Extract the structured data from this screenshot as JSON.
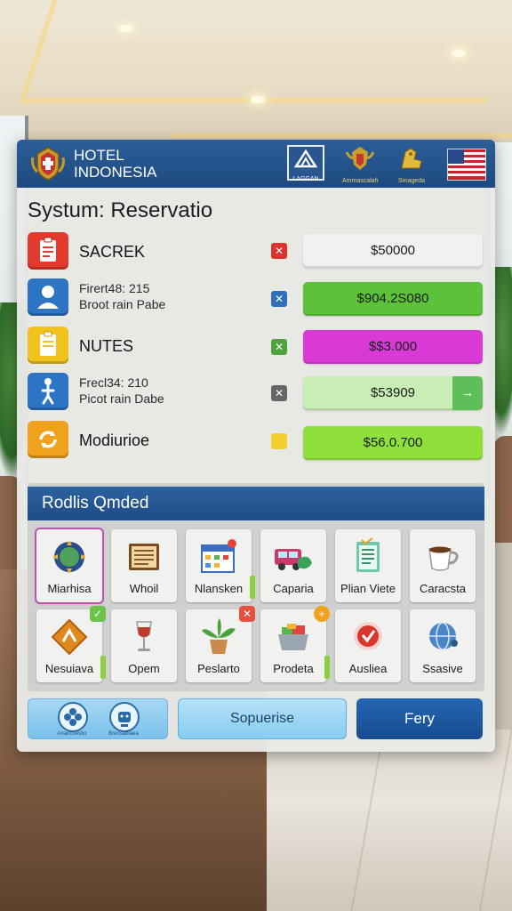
{
  "header": {
    "title_line1": "HOTEL",
    "title_line2": "INDONESIA",
    "badge1_label": "LAGGAN",
    "badge2_label": "Ammascalah",
    "badge3_label": "Smageda"
  },
  "page_title": "Systum: Reservatio",
  "rows": [
    {
      "label": "SACREK",
      "sub1": "",
      "sub2": "",
      "value": "$50000",
      "icon": "clipboard-icon",
      "mini_icon": "cross-mark-icon"
    },
    {
      "label": "",
      "sub1": "Firert48: 215",
      "sub2": "Broot rain Pabe",
      "value": "$904.2S080",
      "icon": "user-icon",
      "mini_icon": "tools-icon"
    },
    {
      "label": "NUTES",
      "sub1": "",
      "sub2": "",
      "value": "$$3.000",
      "icon": "notes-icon",
      "mini_icon": "check-grid-icon"
    },
    {
      "label": "",
      "sub1": "Frecl34: 210",
      "sub2": "Picot rain Dabe",
      "value": "$53909",
      "icon": "walking-person-icon",
      "mini_icon": "cross-tools-icon",
      "arrow": "→"
    },
    {
      "label": "Modiurioe",
      "sub1": "",
      "sub2": "",
      "value": "$56.0.700",
      "icon": "refresh-icon",
      "mini_icon": "yellow-square-icon"
    }
  ],
  "modules": {
    "title": "Rodlis Qmded",
    "tiles": [
      {
        "label": "Miarhisa",
        "icon": "emblem-icon"
      },
      {
        "label": "Whoil",
        "icon": "notebook-icon"
      },
      {
        "label": "Nlansken",
        "icon": "calendar-map-icon"
      },
      {
        "label": "Caparia",
        "icon": "truck-icon"
      },
      {
        "label": "Plian Viete",
        "icon": "checklist-icon"
      },
      {
        "label": "Caracsta",
        "icon": "coffee-cup-icon"
      },
      {
        "label": "Nesuiava",
        "icon": "diamond-sign-icon"
      },
      {
        "label": "Opem",
        "icon": "wine-glass-icon"
      },
      {
        "label": "Peslarto",
        "icon": "potted-plant-icon"
      },
      {
        "label": "Prodeta",
        "icon": "laundry-basket-icon"
      },
      {
        "label": "Ausliea",
        "icon": "heart-badge-icon"
      },
      {
        "label": "Ssasive",
        "icon": "globe-icon"
      }
    ]
  },
  "bottom": {
    "left_caption1": "Anancoestio",
    "left_caption2": "Brensadlaea",
    "middle_label": "Sopuerise",
    "right_label": "Fery"
  },
  "colors": {
    "header_blue": "#1d4a80",
    "pill_white": "#f1f1f1",
    "pill_green": "#5cc23a",
    "pill_magenta": "#d93ad6",
    "pill_light_green": "#c8eeb6",
    "pill_lime": "#8fe03a"
  }
}
